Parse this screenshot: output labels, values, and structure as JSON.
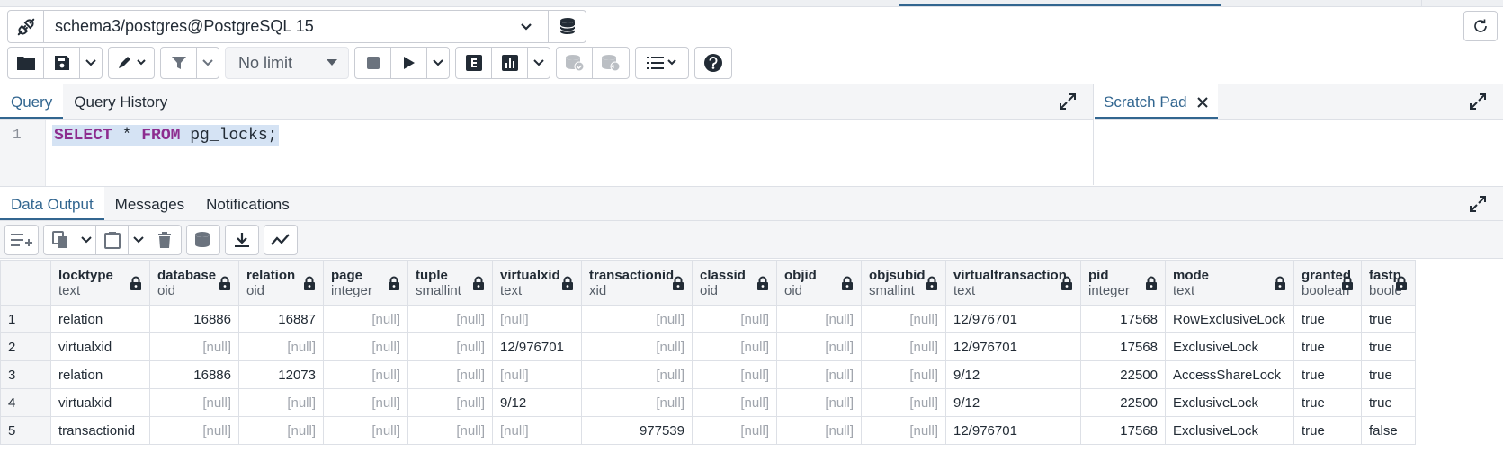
{
  "connection": {
    "label": "schema3/postgres@PostgreSQL 15"
  },
  "toolbar": {
    "limit": "No limit"
  },
  "query_tabs": {
    "query": "Query",
    "history": "Query History"
  },
  "scratch": {
    "label": "Scratch Pad"
  },
  "editor": {
    "line_number": "1",
    "kw1": "SELECT",
    "star": " * ",
    "kw2": "FROM",
    "rest": " pg_locks;"
  },
  "result_tabs": {
    "data": "Data Output",
    "messages": "Messages",
    "notifications": "Notifications"
  },
  "columns": [
    {
      "name": "locktype",
      "type": "text"
    },
    {
      "name": "database",
      "type": "oid"
    },
    {
      "name": "relation",
      "type": "oid"
    },
    {
      "name": "page",
      "type": "integer"
    },
    {
      "name": "tuple",
      "type": "smallint"
    },
    {
      "name": "virtualxid",
      "type": "text"
    },
    {
      "name": "transactionid",
      "type": "xid"
    },
    {
      "name": "classid",
      "type": "oid"
    },
    {
      "name": "objid",
      "type": "oid"
    },
    {
      "name": "objsubid",
      "type": "smallint"
    },
    {
      "name": "virtualtransaction",
      "type": "text"
    },
    {
      "name": "pid",
      "type": "integer"
    },
    {
      "name": "mode",
      "type": "text"
    },
    {
      "name": "granted",
      "type": "boolean"
    },
    {
      "name": "fastp",
      "type": "boole"
    }
  ],
  "rows": [
    [
      "1",
      "relation",
      "16886",
      "16887",
      "[null]",
      "[null]",
      "[null]",
      "[null]",
      "[null]",
      "[null]",
      "[null]",
      "12/976701",
      "17568",
      "RowExclusiveLock",
      "true",
      "true"
    ],
    [
      "2",
      "virtualxid",
      "[null]",
      "[null]",
      "[null]",
      "[null]",
      "12/976701",
      "[null]",
      "[null]",
      "[null]",
      "[null]",
      "12/976701",
      "17568",
      "ExclusiveLock",
      "true",
      "true"
    ],
    [
      "3",
      "relation",
      "16886",
      "12073",
      "[null]",
      "[null]",
      "[null]",
      "[null]",
      "[null]",
      "[null]",
      "[null]",
      "9/12",
      "22500",
      "AccessShareLock",
      "true",
      "true"
    ],
    [
      "4",
      "virtualxid",
      "[null]",
      "[null]",
      "[null]",
      "[null]",
      "9/12",
      "[null]",
      "[null]",
      "[null]",
      "[null]",
      "9/12",
      "22500",
      "ExclusiveLock",
      "true",
      "true"
    ],
    [
      "5",
      "transactionid",
      "[null]",
      "[null]",
      "[null]",
      "[null]",
      "[null]",
      "977539",
      "[null]",
      "[null]",
      "[null]",
      "12/976701",
      "17568",
      "ExclusiveLock",
      "true",
      "false"
    ]
  ],
  "colors": {
    "accent": "#326690",
    "keyword": "#8d2d8f",
    "selection": "#d5e3f4"
  }
}
